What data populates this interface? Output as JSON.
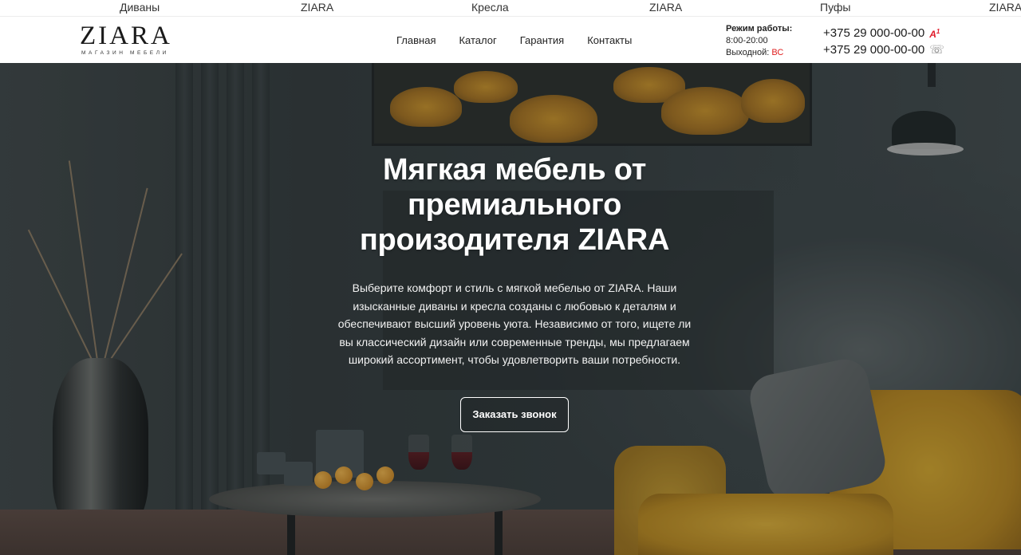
{
  "ticker": {
    "items": [
      "Диваны",
      "ZIARA",
      "Кресла",
      "ZIARA",
      "Пуфы",
      "ZIARA"
    ]
  },
  "header": {
    "logo": {
      "title": "ZIARA",
      "subtitle": "МАГАЗИН МЕБЕЛИ"
    },
    "nav": [
      {
        "label": "Главная"
      },
      {
        "label": "Каталог"
      },
      {
        "label": "Гарантия"
      },
      {
        "label": "Контакты"
      }
    ],
    "hours": {
      "title": "Режим работы:",
      "time": "8:00-20:00",
      "day_off_label": "Выходной:",
      "day_off_value": "ВС"
    },
    "phones": [
      {
        "number": "+375 29 000-00-00",
        "icon": "a1-operator-icon"
      },
      {
        "number": "+375 29 000-00-00",
        "icon": "landline-phone-icon"
      }
    ],
    "a1_icon_text": "A",
    "a1_icon_sup": "1",
    "tel_icon_glyph": "☏"
  },
  "hero": {
    "title": "Мягкая мебель от премиального произодителя ZIARA",
    "text": "Выберите комфорт и стиль с мягкой мебелью от ZIARA. Наши изысканные диваны и кресла созданы с любовью к деталям и обеспечивают высший уровень уюта. Независимо от того, ищете ли вы классический дизайн или современные тренды, мы предлагаем широкий ассортимент, чтобы удовлетворить ваши потребности.",
    "cta_label": "Заказать звонок"
  },
  "colors": {
    "accent_red": "#e02020",
    "chair_yellow": "#c9952a",
    "wall_dark": "#353e41"
  }
}
